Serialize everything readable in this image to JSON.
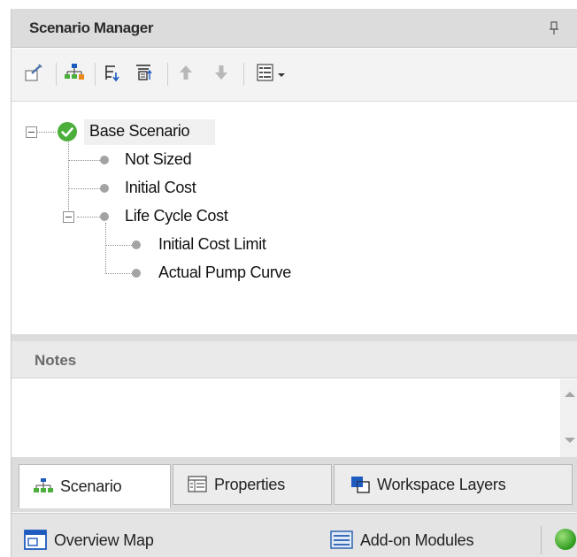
{
  "panel": {
    "title": "Scenario Manager",
    "pin_icon": "pin-icon"
  },
  "toolbar": {
    "buttons": [
      {
        "name": "scenario-properties-button",
        "icon": "edit-scenario-icon"
      },
      {
        "name": "create-child-scenario-button",
        "icon": "hierarchy-icon"
      },
      {
        "name": "sort-tree-button",
        "icon": "sort-icon"
      },
      {
        "name": "filter-tree-button",
        "icon": "filter-icon"
      },
      {
        "name": "move-up-button",
        "icon": "arrow-up-icon"
      },
      {
        "name": "move-down-button",
        "icon": "arrow-down-icon"
      },
      {
        "name": "view-options-dropdown",
        "icon": "list-view-icon"
      }
    ]
  },
  "tree": {
    "root": {
      "label": "Base Scenario",
      "status": "current"
    },
    "children": [
      {
        "label": "Not Sized"
      },
      {
        "label": "Initial Cost"
      },
      {
        "label": "Life Cycle Cost"
      }
    ],
    "grandchildren": [
      {
        "label": "Initial Cost Limit"
      },
      {
        "label": "Actual Pump Curve"
      }
    ]
  },
  "notes": {
    "title": "Notes",
    "value": ""
  },
  "tabs": [
    {
      "label": "Scenario",
      "icon": "hierarchy-icon",
      "active": true
    },
    {
      "label": "Properties",
      "icon": "properties-icon",
      "active": false
    },
    {
      "label": "Workspace Layers",
      "icon": "layers-icon",
      "active": false
    }
  ],
  "statusbar": {
    "overview_map": "Overview Map",
    "addon_modules": "Add-on Modules",
    "status_color": "#2f9b1e"
  },
  "colors": {
    "check": "#4caf3c",
    "accent_blue": "#1e5bbf",
    "accent_orange": "#e8891c"
  }
}
